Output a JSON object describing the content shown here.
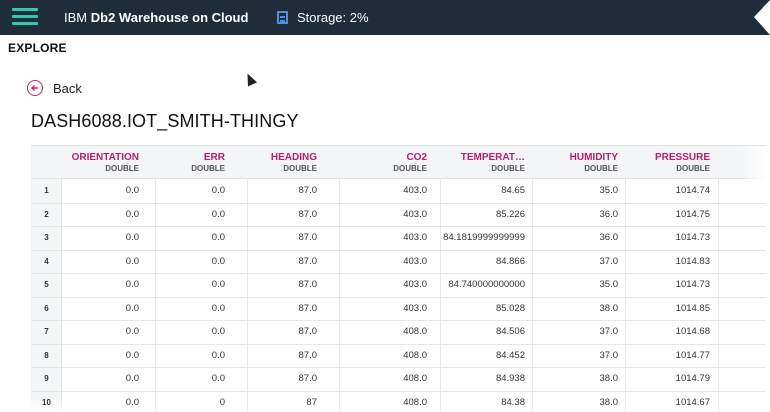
{
  "header": {
    "brand_prefix": "IBM",
    "brand_product": "Db2 Warehouse on Cloud",
    "storage_label": "Storage: 2%"
  },
  "nav": {
    "section": "EXPLORE",
    "back_label": "Back"
  },
  "table": {
    "name": "DASH6088.IOT_SMITH-THINGY",
    "columns": [
      {
        "name": "ORIENTATION",
        "type": "DOUBLE"
      },
      {
        "name": "ERR",
        "type": "DOUBLE"
      },
      {
        "name": "HEADING",
        "type": "DOUBLE"
      },
      {
        "name": "CO2",
        "type": "DOUBLE"
      },
      {
        "name": "TEMPERAT…",
        "type": "DOUBLE"
      },
      {
        "name": "HUMIDITY",
        "type": "DOUBLE"
      },
      {
        "name": "PRESSURE",
        "type": "DOUBLE"
      }
    ],
    "rows": [
      {
        "n": "1",
        "cells": [
          "0.0",
          "0.0",
          "87.0",
          "403.0",
          "84.65",
          "35.0",
          "1014.74"
        ]
      },
      {
        "n": "2",
        "cells": [
          "0.0",
          "0.0",
          "87.0",
          "403.0",
          "85.226",
          "36.0",
          "1014.75"
        ]
      },
      {
        "n": "3",
        "cells": [
          "0.0",
          "0.0",
          "87.0",
          "403.0",
          "84.1819999999999",
          "36.0",
          "1014.73"
        ]
      },
      {
        "n": "4",
        "cells": [
          "0.0",
          "0.0",
          "87.0",
          "403.0",
          "84.866",
          "37.0",
          "1014.83"
        ]
      },
      {
        "n": "5",
        "cells": [
          "0.0",
          "0.0",
          "87.0",
          "403.0",
          "84.740000000000",
          "35.0",
          "1014.73"
        ]
      },
      {
        "n": "6",
        "cells": [
          "0.0",
          "0.0",
          "87.0",
          "403.0",
          "85.028",
          "38.0",
          "1014.85"
        ]
      },
      {
        "n": "7",
        "cells": [
          "0.0",
          "0.0",
          "87.0",
          "408.0",
          "84.506",
          "37.0",
          "1014.68"
        ]
      },
      {
        "n": "8",
        "cells": [
          "0.0",
          "0.0",
          "87.0",
          "408.0",
          "84.452",
          "37.0",
          "1014.77"
        ]
      },
      {
        "n": "9",
        "cells": [
          "0.0",
          "0.0",
          "87.0",
          "408.0",
          "84.938",
          "38.0",
          "1014.79"
        ]
      },
      {
        "n": "10",
        "cells": [
          "0.0",
          "0",
          "87",
          "408.0",
          "84.38",
          "38.0",
          "1014.67"
        ]
      }
    ]
  }
}
